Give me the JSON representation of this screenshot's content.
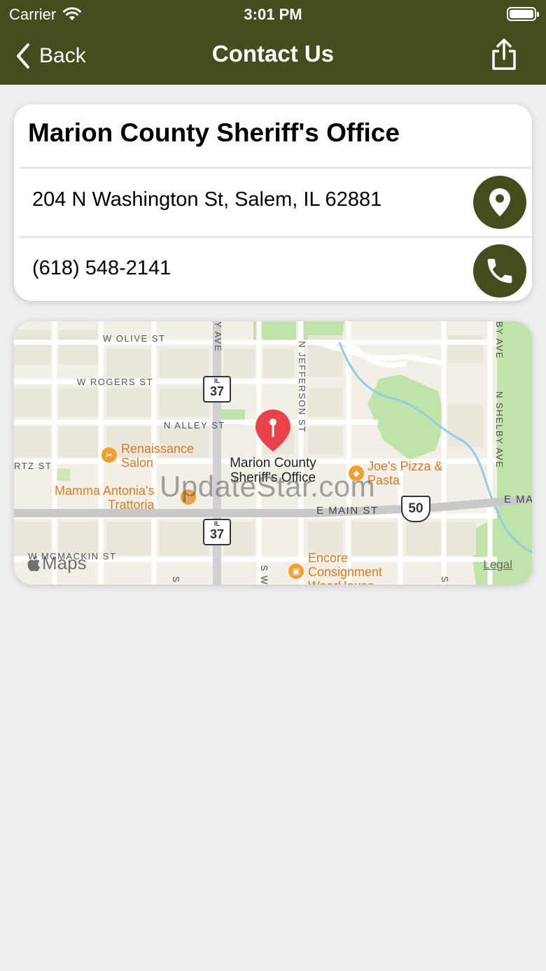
{
  "status_bar": {
    "carrier": "Carrier",
    "time": "3:01 PM"
  },
  "nav": {
    "back_label": "Back",
    "title": "Contact Us"
  },
  "contact": {
    "name": "Marion County Sheriff's Office",
    "address": "204 N Washington St, Salem, IL 62881",
    "phone": "(618) 548-2141"
  },
  "map": {
    "streets": {
      "w_olive": "W OLIVE ST",
      "w_rogers": "W ROGERS ST",
      "n_alley": "N ALLEY ST",
      "rtz": "RTZ ST",
      "e_main": "E MAIN ST",
      "e_main_right": "E MA",
      "w_mcmackin": "W MCMACKIN ST",
      "n_jefferson": "N JEFFERSON ST",
      "n_shelby": "N SHELBY AVE",
      "by_ave": "BY AVE",
      "y_ave": "Y AVE",
      "s_w": "S W",
      "s_left": "S",
      "s_right": "S"
    },
    "pois": {
      "renaissance": "Renaissance\nSalon",
      "mamma": "Mamma Antonia's\nTrattoria",
      "joes": "Joe's Pizza &\nPasta",
      "encore": "Encore\nConsignment\nWearHouse"
    },
    "place_label": "Marion County\nSheriff's Office",
    "routes": {
      "il_top": "IL",
      "il_num": "37",
      "il2_top": "IL",
      "il2_num": "37",
      "us_num": "50"
    },
    "watermark": "UpdateStar.com",
    "brand": "Maps",
    "legal": "Legal"
  },
  "colors": {
    "header_bg": "#474c1e",
    "accent": "#474c1e",
    "pin": "#e8434a"
  }
}
